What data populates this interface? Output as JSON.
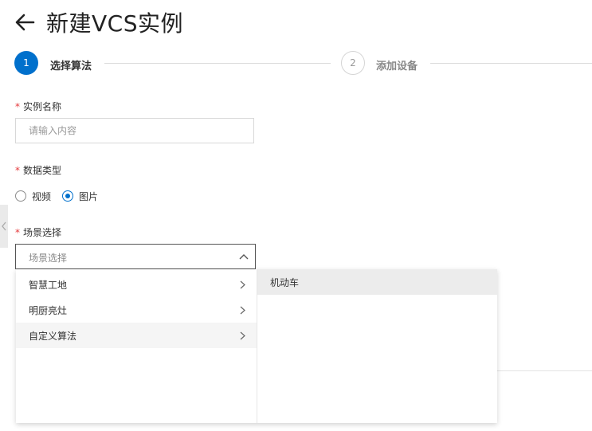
{
  "header": {
    "title": "新建VCS实例"
  },
  "steps": [
    {
      "number": "1",
      "label": "选择算法",
      "state": "active"
    },
    {
      "number": "2",
      "label": "添加设备",
      "state": "inactive"
    }
  ],
  "form": {
    "instance_name": {
      "required_mark": "*",
      "label": "实例名称",
      "value": "",
      "placeholder": "请输入内容"
    },
    "data_type": {
      "required_mark": "*",
      "label": "数据类型",
      "options": [
        {
          "label": "视频",
          "checked": false
        },
        {
          "label": "图片",
          "checked": true
        }
      ]
    },
    "scene": {
      "required_mark": "*",
      "label": "场景选择",
      "placeholder": "场景选择"
    }
  },
  "cascader": {
    "level1": [
      {
        "label": "智慧工地",
        "state": "normal"
      },
      {
        "label": "明厨亮灶",
        "state": "normal"
      },
      {
        "label": "自定义算法",
        "state": "hover"
      }
    ],
    "level2": [
      {
        "label": "机动车",
        "state": "selected"
      }
    ]
  },
  "colors": {
    "accent": "#0070cc",
    "required": "#e4393c"
  },
  "icons": {
    "back": "arrow-left-icon",
    "select_toggle": "chevron-up-icon",
    "submenu": "chevron-right-icon",
    "side_handle": "chevron-left-icon"
  }
}
